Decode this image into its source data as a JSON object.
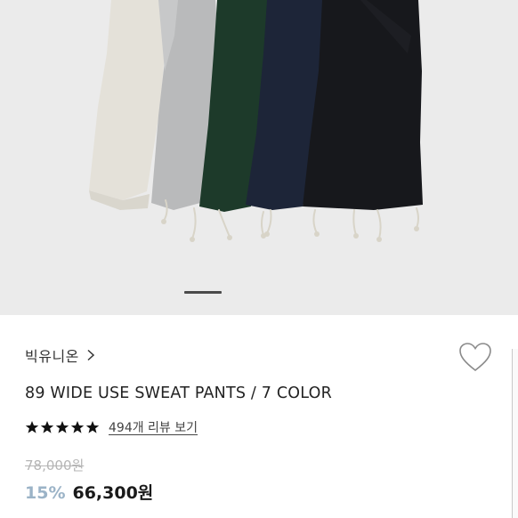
{
  "hero": {
    "image_description_icon": "sweatpants-photo",
    "carousel": {
      "current": 1
    }
  },
  "product": {
    "brand": "빅유니온",
    "title": "89 WIDE USE SWEAT PANTS / 7 COLOR",
    "rating": 5,
    "review_link": "494개 리뷰 보기",
    "original_price": "78,000원",
    "discount": "15%",
    "sale_price": "66,300원",
    "wishlist_icon": "heart-outline-icon"
  },
  "colors": {
    "discount": "#9bb3c7",
    "star": "#111111",
    "hero_bg": "#ebebeb"
  }
}
